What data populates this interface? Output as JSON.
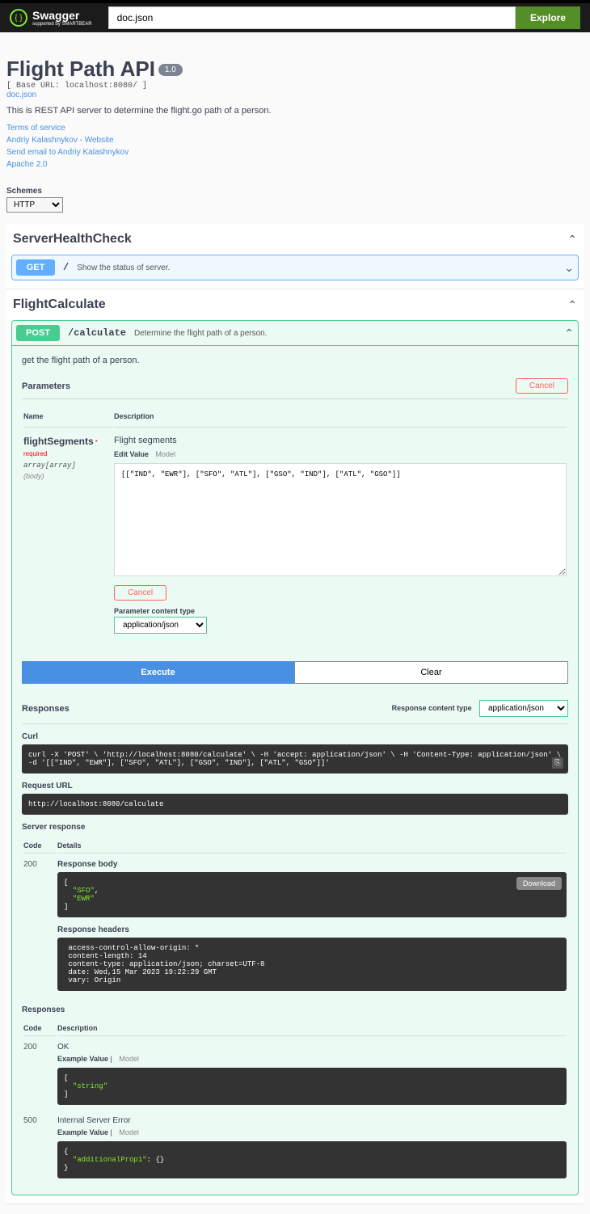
{
  "topbar": {
    "logo": "Swagger",
    "logo_sub": "supported by SMARTBEAR",
    "search_value": "doc.json",
    "explore": "Explore"
  },
  "info": {
    "title": "Flight Path API",
    "version": "1.0",
    "base_url": "[ Base URL: localhost:8080/ ]",
    "spec_link": "doc.json",
    "description": "This is REST API server to determine the flight.go path of a person.",
    "terms": "Terms of service",
    "contact_name": "Andriy Kalashnykov - Website",
    "contact_email": "Send email to Andriy Kalashnykov",
    "license": "Apache 2.0"
  },
  "schemes": {
    "label": "Schemes",
    "selected": "HTTP"
  },
  "tag1": {
    "name": "ServerHealthCheck",
    "op_method": "GET",
    "op_path": "/",
    "op_desc": "Show the status of server."
  },
  "tag2": {
    "name": "FlightCalculate",
    "op_method": "POST",
    "op_path": "/calculate",
    "op_summary": "Determine the flight path of a person.",
    "op_description": "get the flight path of a person."
  },
  "params": {
    "header": "Parameters",
    "cancel": "Cancel",
    "col_name": "Name",
    "col_desc": "Description",
    "p_name": "flightSegments",
    "p_required": "* required",
    "p_type": "array[array]",
    "p_in": "(body)",
    "p_desc": "Flight segments",
    "edit_value": "Edit Value",
    "model": "Model",
    "body_value": "[[\"IND\", \"EWR\"], [\"SFO\", \"ATL\"], [\"GSO\", \"IND\"], [\"ATL\", \"GSO\"]]",
    "cancel2": "Cancel",
    "ct_label": "Parameter content type",
    "ct_value": "application/json"
  },
  "actions": {
    "execute": "Execute",
    "clear": "Clear"
  },
  "responses": {
    "header": "Responses",
    "ct_label": "Response content type",
    "ct_value": "application/json"
  },
  "live": {
    "curl_label": "Curl",
    "curl": "curl -X 'POST' \\ 'http://localhost:8080/calculate' \\ -H 'accept: application/json' \\ -H 'Content-Type: application/json' \\ -d '[[\"IND\", \"EWR\"], [\"SFO\", \"ATL\"], [\"GSO\", \"IND\"], [\"ATL\", \"GSO\"]]'",
    "req_url_label": "Request URL",
    "req_url": "http://localhost:8080/calculate",
    "server_resp": "Server response",
    "col_code": "Code",
    "col_details": "Details",
    "code200": "200",
    "body_label": "Response body",
    "body": "[\n  \"SFO\",\n  \"EWR\"\n]",
    "download": "Download",
    "headers_label": "Response headers",
    "headers": " access-control-allow-origin: *\n content-length: 14\n content-type: application/json; charset=UTF-8\n date: Wed,15 Mar 2023 19:22:29 GMT\n vary: Origin"
  },
  "doc_responses": {
    "label": "Responses",
    "col_code": "Code",
    "col_desc": "Description",
    "r200_code": "200",
    "r200_desc": "OK",
    "example_value": "Example Value",
    "model": "Model",
    "r200_body": "[\n  \"string\"\n]",
    "r500_code": "500",
    "r500_desc": "Internal Server Error",
    "r500_body": "{\n  \"additionalProp1\": {}\n}"
  }
}
